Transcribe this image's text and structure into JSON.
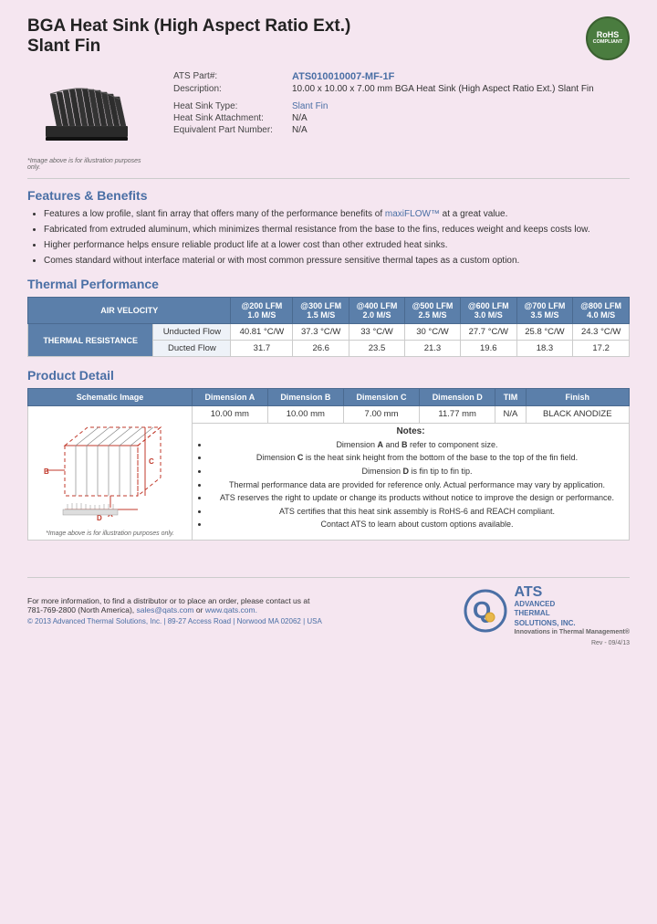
{
  "header": {
    "title_line1": "BGA Heat Sink (High Aspect Ratio Ext.)",
    "title_line2": "Slant Fin",
    "rohs": {
      "label": "RoHS",
      "sublabel": "COMPLIANT"
    }
  },
  "product_info": {
    "part_label": "ATS Part#:",
    "part_number": "ATS010010007-MF-1F",
    "description_label": "Description:",
    "description": "10.00 x 10.00 x 7.00 mm BGA Heat Sink (High Aspect Ratio Ext.) Slant Fin",
    "type_label": "Heat Sink Type:",
    "type_value": "Slant Fin",
    "attachment_label": "Heat Sink Attachment:",
    "attachment_value": "N/A",
    "equiv_part_label": "Equivalent Part Number:",
    "equiv_part_value": "N/A",
    "image_caption": "*Image above is for illustration purposes only."
  },
  "features": {
    "heading": "Features & Benefits",
    "items": [
      "Features a low profile, slant fin array that offers many of the performance benefits of maxiFLOW™ at a great value.",
      "Fabricated from extruded aluminum, which minimizes thermal resistance from the base to the fins, reduces weight and keeps costs low.",
      "Higher performance helps ensure reliable product life at a lower cost than other extruded heat sinks.",
      "Comes standard without interface material or with most common pressure sensitive thermal tapes as a custom option."
    ],
    "maxiflow_link": "maxiFLOW™"
  },
  "thermal_performance": {
    "heading": "Thermal Performance",
    "col_headers": [
      {
        "line1": "",
        "line2": "AIR VELOCITY"
      },
      {
        "line1": "@200 LFM",
        "line2": "1.0 M/S"
      },
      {
        "line1": "@300 LFM",
        "line2": "1.5 M/S"
      },
      {
        "line1": "@400 LFM",
        "line2": "2.0 M/S"
      },
      {
        "line1": "@500 LFM",
        "line2": "2.5 M/S"
      },
      {
        "line1": "@600 LFM",
        "line2": "3.0 M/S"
      },
      {
        "line1": "@700 LFM",
        "line2": "3.5 M/S"
      },
      {
        "line1": "@800 LFM",
        "line2": "4.0 M/S"
      }
    ],
    "row_side_header": "THERMAL RESISTANCE",
    "rows": [
      {
        "label": "Unducted Flow",
        "values": [
          "40.81 °C/W",
          "37.3 °C/W",
          "33 °C/W",
          "30 °C/W",
          "27.7 °C/W",
          "25.8 °C/W",
          "24.3 °C/W"
        ]
      },
      {
        "label": "Ducted Flow",
        "values": [
          "31.7",
          "26.6",
          "23.5",
          "21.3",
          "19.6",
          "18.3",
          "17.2"
        ]
      }
    ]
  },
  "product_detail": {
    "heading": "Product Detail",
    "col_headers": [
      "Schematic Image",
      "Dimension A",
      "Dimension B",
      "Dimension C",
      "Dimension D",
      "TIM",
      "Finish"
    ],
    "dim_values": [
      "10.00 mm",
      "10.00 mm",
      "7.00 mm",
      "11.77 mm",
      "N/A",
      "BLACK ANODIZE"
    ],
    "schematic_caption": "*Image above is for illustration purposes only.",
    "notes_title": "Notes:",
    "notes": [
      "Dimension A and B refer to component size.",
      "Dimension C is the heat sink height from the bottom of the base to the top of the fin field.",
      "Dimension D is fin tip to fin tip.",
      "Thermal performance data are provided for reference only. Actual performance may vary by application.",
      "ATS reserves the right to update or change its products without notice to improve the design or performance.",
      "ATS certifies that this heat sink assembly is RoHS-6 and REACH compliant.",
      "Contact ATS to learn about custom options available."
    ]
  },
  "footer": {
    "contact_text": "For more information, to find a distributor or to place an order, please contact us at",
    "phone": "781-769-2800 (North America),",
    "email": "sales@qats.com",
    "email_connector": "or",
    "website": "www.qats.com.",
    "copyright": "© 2013 Advanced Thermal Solutions, Inc.  |  89-27 Access Road  |  Norwood MA  02062  |  USA",
    "ats_name_line1": "ADVANCED",
    "ats_name_line2": "THERMAL",
    "ats_name_line3": "SOLUTIONS, INC.",
    "ats_tagline": "Innovations in Thermal Management®",
    "page_number": "Rev - 09/4/13"
  }
}
